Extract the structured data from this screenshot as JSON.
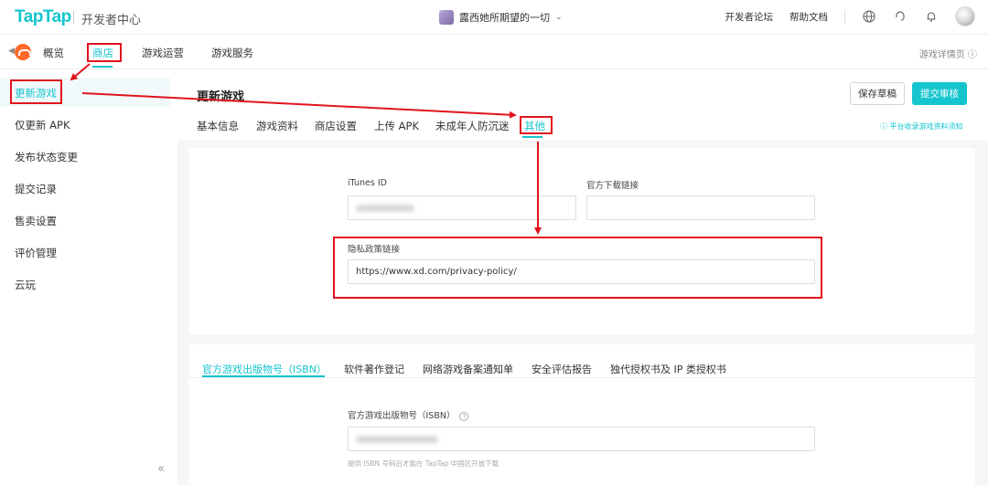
{
  "topbar": {
    "logo": "TapTap",
    "logo_sub": "开发者中心",
    "game_name": "露西她所期望的一切",
    "links": [
      "开发者论坛",
      "帮助文档"
    ]
  },
  "subnav": {
    "items": [
      "概览",
      "商店",
      "游戏运营",
      "游戏服务"
    ],
    "active": "商店",
    "details_link": "游戏详情页"
  },
  "sidebar": {
    "items": [
      "更新游戏",
      "仅更新 APK",
      "发布状态变更",
      "提交记录",
      "售卖设置",
      "评价管理",
      "云玩"
    ],
    "active": "更新游戏",
    "collapse": "«"
  },
  "main": {
    "title": "更新游戏",
    "save_label": "保存草稿",
    "submit_label": "提交审核",
    "tabs": [
      "基本信息",
      "游戏资料",
      "商店设置",
      "上传 APK",
      "未成年人防沉迷",
      "其他"
    ],
    "active_tab": "其他",
    "notice": "平台收录游戏资料须知"
  },
  "form": {
    "itunes_label": "iTunes ID",
    "download_label": "官方下载链接",
    "privacy_label": "隐私政策链接",
    "privacy_value": "https://www.xd.com/privacy-policy/"
  },
  "license": {
    "tabs": [
      "官方游戏出版物号（ISBN）",
      "软件著作登记",
      "网络游戏备案通知单",
      "安全评估报告",
      "独代授权书及 IP 类授权书"
    ],
    "active_tab": "官方游戏出版物号（ISBN）",
    "isbn_label": "官方游戏出版物号（ISBN）",
    "isbn_hint": "提供 ISBN 号码后才能在 TapTap 中国区开放下载"
  },
  "colors": {
    "accent": "#15c5ce",
    "annotation": "#e0141e"
  }
}
